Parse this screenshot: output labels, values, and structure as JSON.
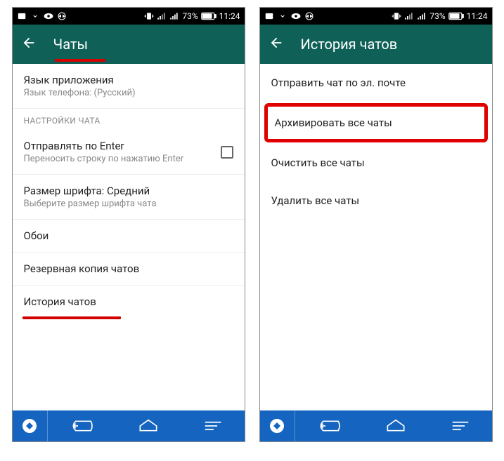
{
  "status_bar": {
    "battery_text": "73%",
    "time": "11:24"
  },
  "screen1": {
    "title": "Чаты",
    "lang_title": "Язык приложения",
    "lang_sub": "Язык телефона: (Русский)",
    "section": "НАСТРОЙКИ ЧАТА",
    "enter_title": "Отправлять по Enter",
    "enter_sub": "Переносить строку по нажатию Enter",
    "font_title": "Размер шрифта: Средний",
    "font_sub": "Выберите размер шрифта чата",
    "wallpaper": "Обои",
    "backup": "Резервная копия чатов",
    "history": "История чатов"
  },
  "screen2": {
    "title": "История чатов",
    "email": "Отправить чат по эл. почте",
    "archive": "Архивировать все чаты",
    "clear": "Очистить все чаты",
    "delete": "Удалить все чаты"
  }
}
